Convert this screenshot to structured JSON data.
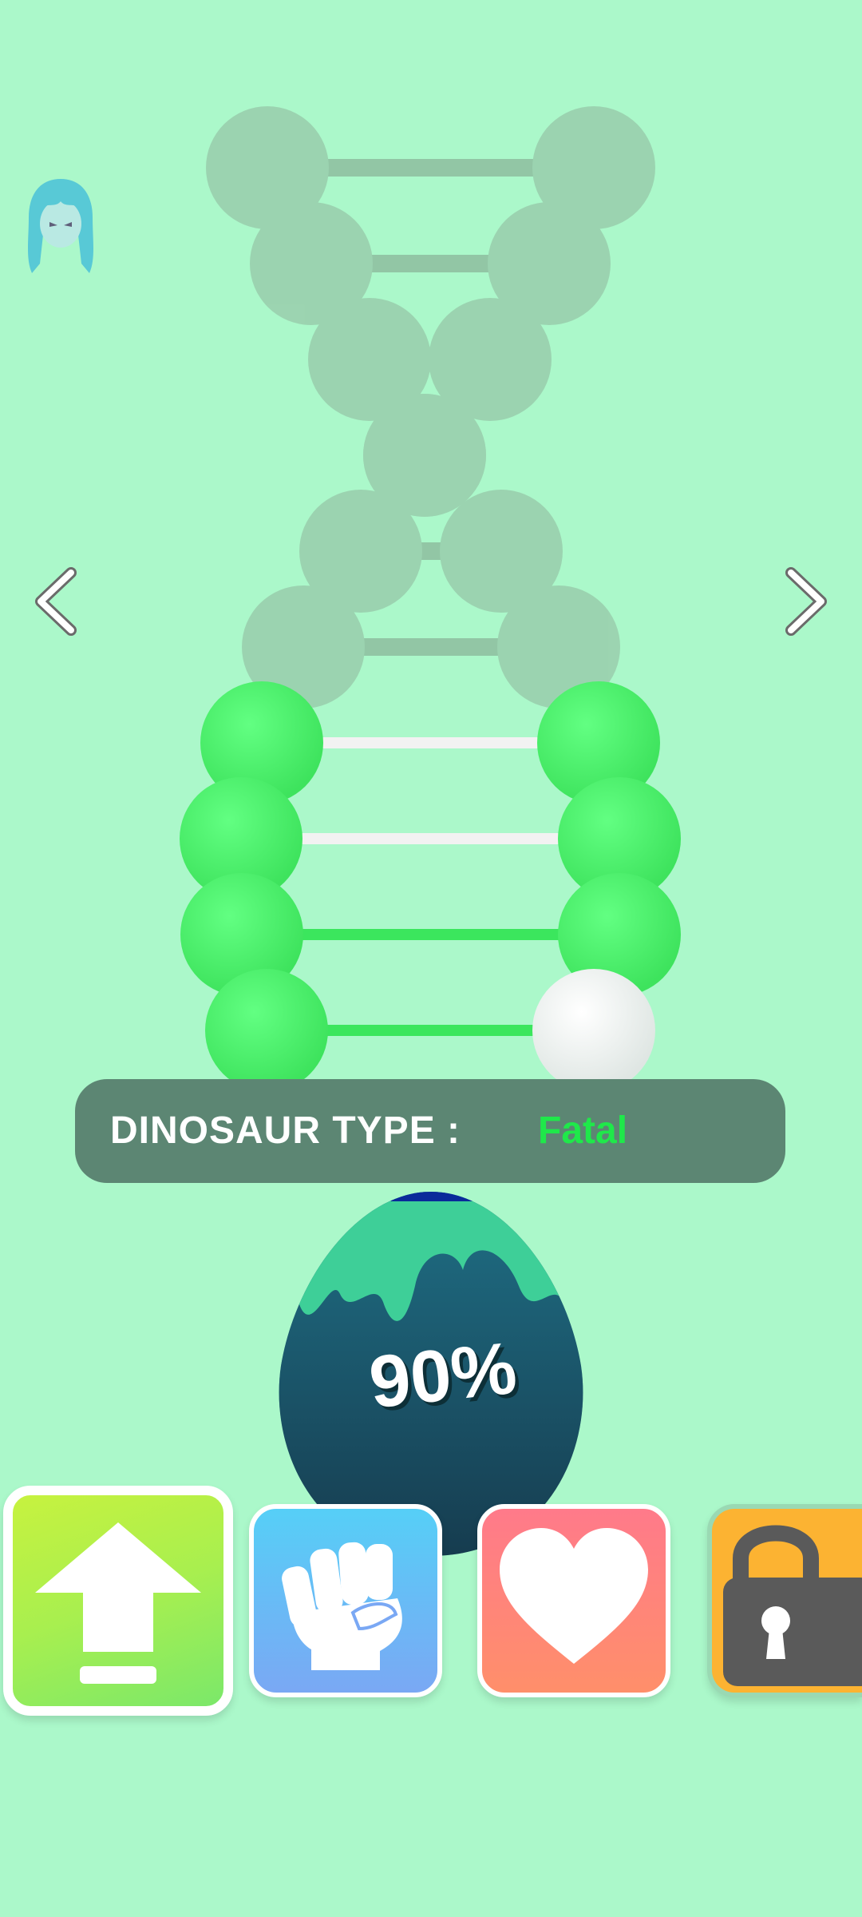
{
  "top_bar": {
    "avatar_icon": "character-avatar-icon"
  },
  "navigation": {
    "prev_icon": "chevron-left-icon",
    "next_icon": "chevron-right-icon"
  },
  "dna": {
    "icon": "dna-helix",
    "rungs_total": 10,
    "rungs_active": 4,
    "colors": {
      "active_ball": "#4cf56b",
      "inactive_ball": "#8fb69c",
      "empty_ball": "#ffffff",
      "active_bar": "#3be65d",
      "empty_bar": "#f2f2f2"
    }
  },
  "dinosaur_type": {
    "label": "DINOSAUR TYPE :",
    "value": "Fatal",
    "value_color": "#1fe84a"
  },
  "egg": {
    "progress_text": "90%",
    "progress": 0.9
  },
  "cards": [
    {
      "name": "upgrade",
      "icon": "arrow-up-icon",
      "selected": true
    },
    {
      "name": "power",
      "icon": "fist-icon",
      "selected": false
    },
    {
      "name": "health",
      "icon": "heart-icon",
      "selected": false
    },
    {
      "name": "locked",
      "icon": "padlock-icon",
      "selected": false
    }
  ]
}
